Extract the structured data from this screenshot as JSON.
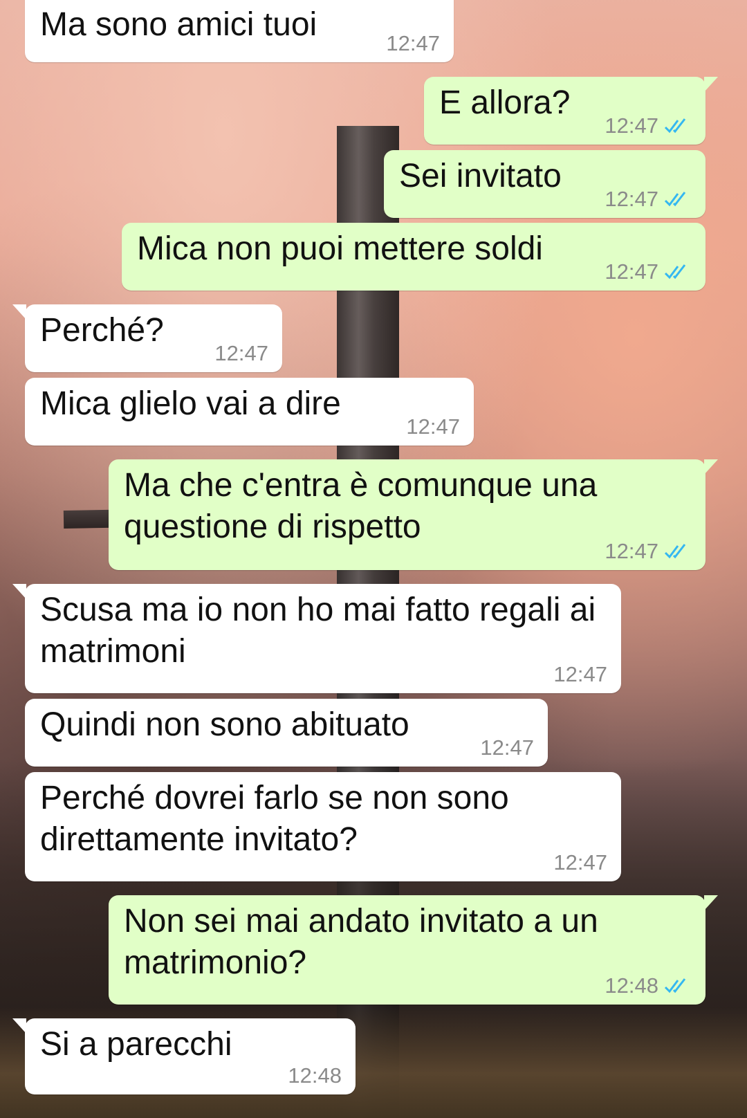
{
  "theme": {
    "incoming_bg": "#ffffff",
    "outgoing_bg": "#e1ffc7",
    "time_color": "#8a8a8a",
    "read_tick_color": "#34b7f1"
  },
  "messages": [
    {
      "dir": "in",
      "text": "Ma sono amici tuoi",
      "time": "12:47"
    },
    {
      "dir": "out",
      "text": "E allora?",
      "time": "12:47",
      "status": "read"
    },
    {
      "dir": "out",
      "text": "Sei invitato",
      "time": "12:47",
      "status": "read"
    },
    {
      "dir": "out",
      "text": "Mica non puoi mettere soldi",
      "time": "12:47",
      "status": "read"
    },
    {
      "dir": "in",
      "text": "Perché?",
      "time": "12:47"
    },
    {
      "dir": "in",
      "text": "Mica glielo vai a dire",
      "time": "12:47"
    },
    {
      "dir": "out",
      "text": "Ma che c'entra è comunque una questione di rispetto",
      "time": "12:47",
      "status": "read"
    },
    {
      "dir": "in",
      "text": "Scusa ma io non ho mai fatto regali ai matrimoni",
      "time": "12:47"
    },
    {
      "dir": "in",
      "text": "Quindi non sono abituato",
      "time": "12:47"
    },
    {
      "dir": "in",
      "text": "Perché dovrei farlo se non sono direttamente invitato?",
      "time": "12:47"
    },
    {
      "dir": "out",
      "text": "Non sei mai andato invitato a un matrimonio?",
      "time": "12:48",
      "status": "read"
    },
    {
      "dir": "in",
      "text": "Si a parecchi",
      "time": "12:48"
    }
  ]
}
